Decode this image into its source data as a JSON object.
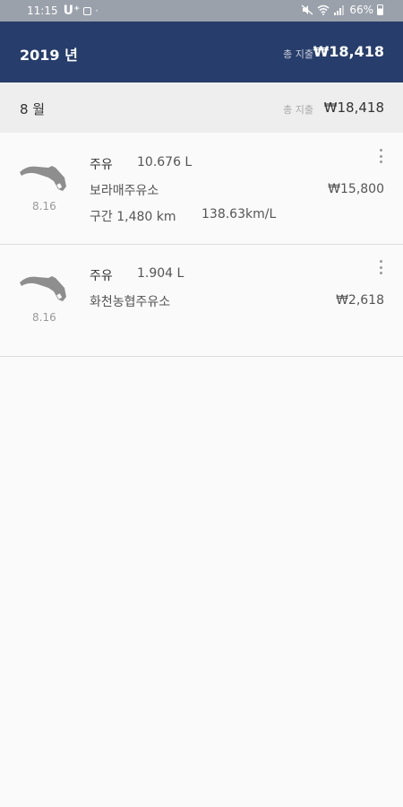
{
  "status_bar": {
    "time": "11:15",
    "carrier": "U⁺",
    "battery": "66%"
  },
  "header": {
    "year": "2019 년",
    "total_label": "총 지출",
    "total_value": "₩18,418"
  },
  "month": {
    "label": "8 월",
    "total_label": "총 지출",
    "total_value": "₩18,418"
  },
  "records": [
    {
      "date": "8.16",
      "type": "주유",
      "amount": "10.676 L",
      "station": "보라매주유소",
      "price": "₩15,800",
      "distance": "구간 1,480 km",
      "efficiency": "138.63km/L"
    },
    {
      "date": "8.16",
      "type": "주유",
      "amount": "1.904 L",
      "station": "화천농협주유소",
      "price": "₩2,618"
    }
  ],
  "colors": {
    "header": "#273d6b",
    "status_bar": "#9aa1ab",
    "icon_gray": "#8e8e8e"
  },
  "icons": [
    "fuel-nozzle-icon",
    "more-vert-icon",
    "wifi-icon",
    "signal-icon",
    "battery-icon",
    "mute-icon"
  ]
}
